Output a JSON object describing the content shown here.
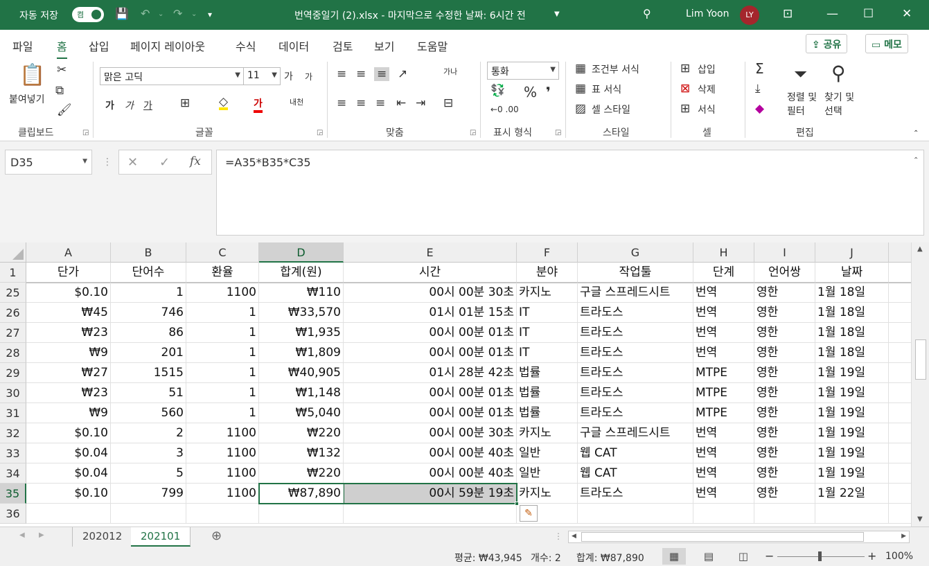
{
  "titlebar": {
    "autosave_label": "자동 저장",
    "toggle_state": "켬",
    "title": "번역중일기 (2).xlsx  -  마지막으로 수정한 날짜: 6시간 전",
    "user_name": "Lim Yoon",
    "user_initials": "LY",
    "accent_color": "#217346"
  },
  "menu": {
    "tabs": [
      "파일",
      "홈",
      "삽입",
      "페이지 레이아웃",
      "수식",
      "데이터",
      "검토",
      "보기",
      "도움말"
    ],
    "active_tab": "홈",
    "share_label": "공유",
    "memo_label": "메모"
  },
  "ribbon": {
    "clipboard": {
      "paste_label": "붙여넣기",
      "group_label": "클립보드"
    },
    "font": {
      "font_name": "맑은 고딕",
      "font_size": "11",
      "bold": "가",
      "italic": "가",
      "underline": "가",
      "grow": "가",
      "shrink": "가",
      "font_color_glyph": "가",
      "group_label": "글꼴"
    },
    "alignment": {
      "group_label": "맞춤"
    },
    "number": {
      "format": "통화",
      "group_label": "표시 형식"
    },
    "styles": {
      "conditional": "조건부 서식",
      "table": "표 서식",
      "cell_style": "셀 스타일",
      "group_label": "스타일"
    },
    "cells": {
      "insert": "삽입",
      "delete": "삭제",
      "format": "서식",
      "group_label": "셀"
    },
    "editing": {
      "sort_filter": "정렬 및\n필터",
      "find_select": "찾기 및\n선택",
      "group_label": "편집"
    }
  },
  "formula_bar": {
    "name_box": "D35",
    "formula": "=A35*B35*C35"
  },
  "sheet": {
    "columns": [
      "A",
      "B",
      "C",
      "D",
      "E",
      "F",
      "G",
      "H",
      "I",
      "J"
    ],
    "selected_column": "D",
    "selected_row": "35",
    "header_row": {
      "row_number": "1",
      "cells": [
        "단가",
        "단어수",
        "환율",
        "합계(원)",
        "시간",
        "분야",
        "작업툴",
        "단계",
        "언어쌍",
        "날짜"
      ]
    },
    "rows": [
      {
        "row_number": "25",
        "cells": [
          "$0.10",
          "1",
          "1100",
          "₩110",
          "00시 00분 30초",
          "카지노",
          "구글 스프레드시트",
          "번역",
          "영한",
          "1월 18일"
        ]
      },
      {
        "row_number": "26",
        "cells": [
          "₩45",
          "746",
          "1",
          "₩33,570",
          "01시 01분 15초",
          "IT",
          "트라도스",
          "번역",
          "영한",
          "1월 18일"
        ]
      },
      {
        "row_number": "27",
        "cells": [
          "₩23",
          "86",
          "1",
          "₩1,935",
          "00시 00분 01초",
          "IT",
          "트라도스",
          "번역",
          "영한",
          "1월 18일"
        ]
      },
      {
        "row_number": "28",
        "cells": [
          "₩9",
          "201",
          "1",
          "₩1,809",
          "00시 00분 01초",
          "IT",
          "트라도스",
          "번역",
          "영한",
          "1월 18일"
        ]
      },
      {
        "row_number": "29",
        "cells": [
          "₩27",
          "1515",
          "1",
          "₩40,905",
          "01시 28분 42초",
          "법률",
          "트라도스",
          "MTPE",
          "영한",
          "1월 19일"
        ]
      },
      {
        "row_number": "30",
        "cells": [
          "₩23",
          "51",
          "1",
          "₩1,148",
          "00시 00분 01초",
          "법률",
          "트라도스",
          "MTPE",
          "영한",
          "1월 19일"
        ]
      },
      {
        "row_number": "31",
        "cells": [
          "₩9",
          "560",
          "1",
          "₩5,040",
          "00시 00분 01초",
          "법률",
          "트라도스",
          "MTPE",
          "영한",
          "1월 19일"
        ]
      },
      {
        "row_number": "32",
        "cells": [
          "$0.10",
          "2",
          "1100",
          "₩220",
          "00시 00분 30초",
          "카지노",
          "구글 스프레드시트",
          "번역",
          "영한",
          "1월 19일"
        ]
      },
      {
        "row_number": "33",
        "cells": [
          "$0.04",
          "3",
          "1100",
          "₩132",
          "00시 00분 40초",
          "일반",
          "웹 CAT",
          "번역",
          "영한",
          "1월 19일"
        ]
      },
      {
        "row_number": "34",
        "cells": [
          "$0.04",
          "5",
          "1100",
          "₩220",
          "00시 00분 40초",
          "일반",
          "웹 CAT",
          "번역",
          "영한",
          "1월 19일"
        ]
      },
      {
        "row_number": "35",
        "cells": [
          "$0.10",
          "799",
          "1100",
          "₩87,890",
          "00시 59분 19초",
          "카지노",
          "트라도스",
          "번역",
          "영한",
          "1월 22일"
        ]
      },
      {
        "row_number": "36",
        "cells": [
          "",
          "",
          "",
          "",
          "",
          "",
          "",
          "",
          "",
          ""
        ]
      }
    ]
  },
  "sheet_tabs": {
    "tabs": [
      "202012",
      "202101"
    ],
    "active": "202101"
  },
  "status_bar": {
    "average": "평균: ₩43,945",
    "count": "개수: 2",
    "sum": "합계: ₩87,890",
    "zoom": "100%"
  }
}
